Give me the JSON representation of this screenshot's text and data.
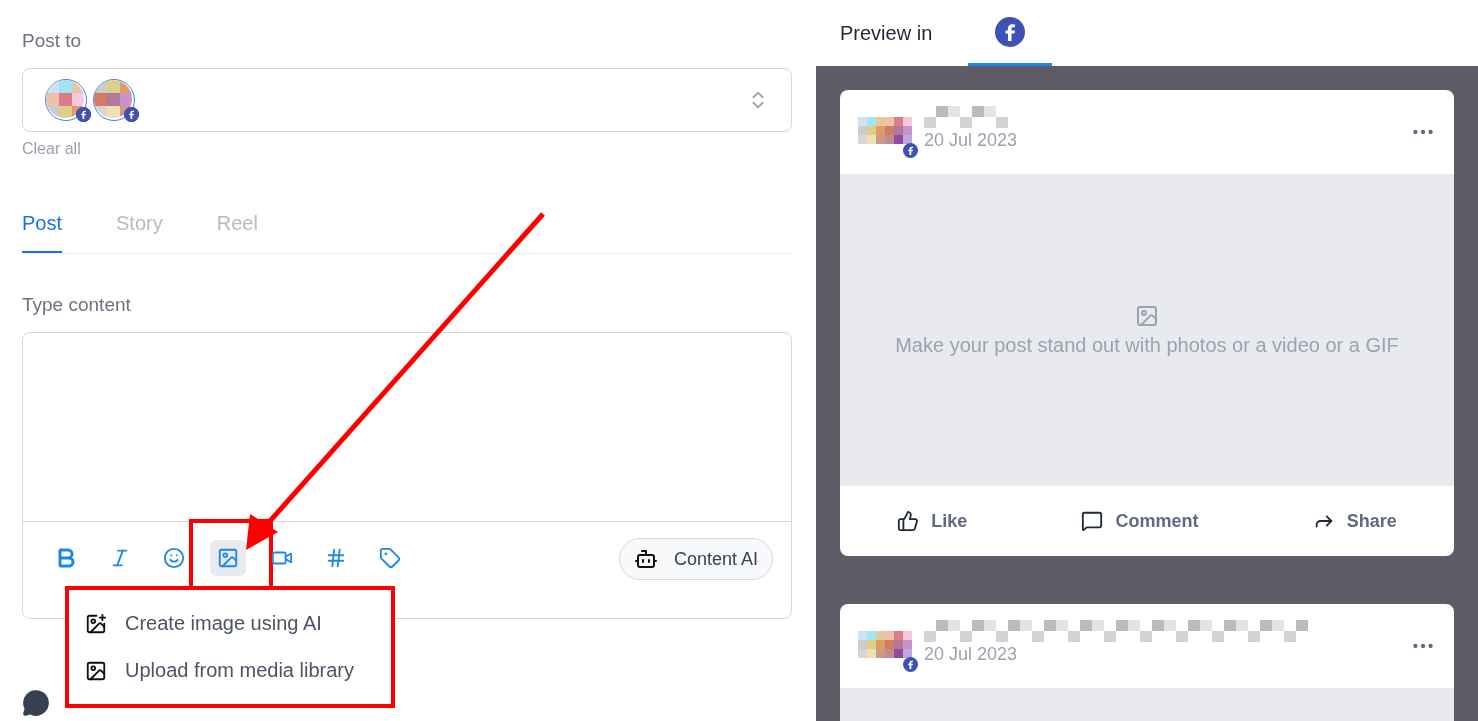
{
  "post_to": {
    "label": "Post to",
    "clear": "Clear all"
  },
  "tabs": [
    {
      "label": "Post",
      "selected": true
    },
    {
      "label": "Story",
      "selected": false
    },
    {
      "label": "Reel",
      "selected": false
    }
  ],
  "content": {
    "label": "Type content",
    "toolbar": [
      {
        "kind": "bold",
        "selected": false
      },
      {
        "kind": "italic",
        "selected": false
      },
      {
        "kind": "emoji",
        "selected": false
      },
      {
        "kind": "image",
        "selected": true
      },
      {
        "kind": "video",
        "selected": false
      },
      {
        "kind": "hashtag",
        "selected": false
      },
      {
        "kind": "tag",
        "selected": false
      }
    ],
    "ai_button": "Content AI"
  },
  "media_menu": {
    "items": [
      {
        "kind": "ai",
        "label": "Create image using AI"
      },
      {
        "kind": "library",
        "label": "Upload from media library"
      }
    ]
  },
  "preview": {
    "label": "Preview in",
    "networks": [
      {
        "selected": true
      }
    ],
    "posts": [
      {
        "date": "20 Jul 2023",
        "media_hint": "Make your post stand out with photos or a video or a GIF",
        "actions": [
          {
            "kind": "like",
            "label": "Like"
          },
          {
            "kind": "comment",
            "label": "Comment"
          },
          {
            "kind": "share",
            "label": "Share"
          }
        ]
      },
      {
        "date": "20 Jul 2023"
      }
    ]
  }
}
